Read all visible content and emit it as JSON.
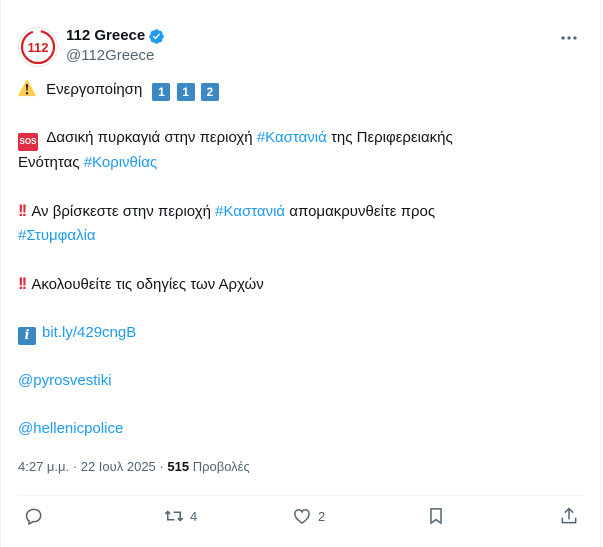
{
  "header": {
    "display_name": "112 Greece",
    "handle": "@112Greece",
    "avatar_text": "112",
    "more_icon": "more-icon"
  },
  "post": {
    "line1_text": "Ενεργοποίηση",
    "line1_keycaps": [
      "1",
      "1",
      "2"
    ],
    "line2_a": "Δασική πυρκαγιά στην περιοχή ",
    "line2_tag": "#Καστανιά",
    "line2_b": " της Περιφερειακής",
    "line3_a": "Ενότητας ",
    "line3_tag": "#Κορινθίας",
    "line4_a": "Αν βρίσκεστε στην περιοχή ",
    "line4_tag": "#Καστανιά",
    "line4_b": " απομακρυνθείτε προς",
    "line5_tag": "#Στυμφαλία",
    "line6": "Ακολουθείτε τις οδηγίες των Αρχών",
    "link": "bit.ly/429cngB",
    "mention1": "@pyrosvestiki",
    "mention2": "@hellenicpolice",
    "sos_label": "SOS",
    "info_label": "i"
  },
  "meta": {
    "time": "4:27 μ.μ.",
    "separator": "·",
    "date": "22 Ιουλ 2025",
    "views_count": "515",
    "views_label": "Προβολές"
  },
  "actions": {
    "reply_count": "",
    "repost_count": "4",
    "like_count": "2"
  },
  "colors": {
    "accent": "#1d9bf0",
    "text": "#0f1419",
    "muted": "#536471",
    "logo_red": "#d71f26",
    "verified": "#1d9bf0"
  }
}
